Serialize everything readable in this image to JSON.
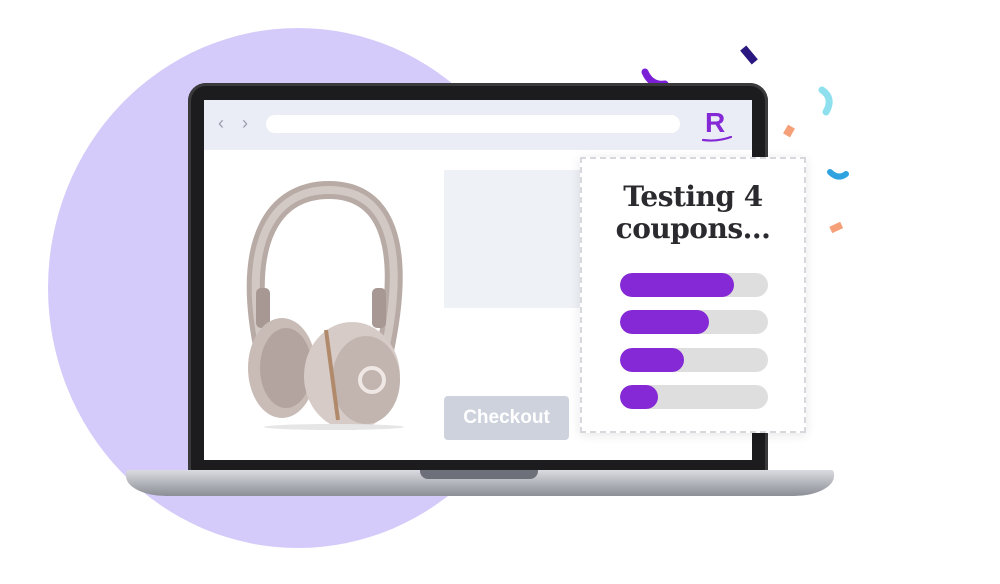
{
  "browser": {
    "nav_back_icon": "‹",
    "nav_forward_icon": "›",
    "brand_logo_letter": "R"
  },
  "product": {
    "image": "headphones-icon",
    "checkout_label": "Checkout"
  },
  "coupon_card": {
    "title_line1": "Testing 4",
    "title_line2": "coupons...",
    "progress": [
      0.77,
      0.6,
      0.43,
      0.26
    ]
  },
  "colors": {
    "accent_purple": "#8529d6",
    "circle_lavender": "#d5cbfa",
    "button_disabled": "#cdd2dc"
  }
}
